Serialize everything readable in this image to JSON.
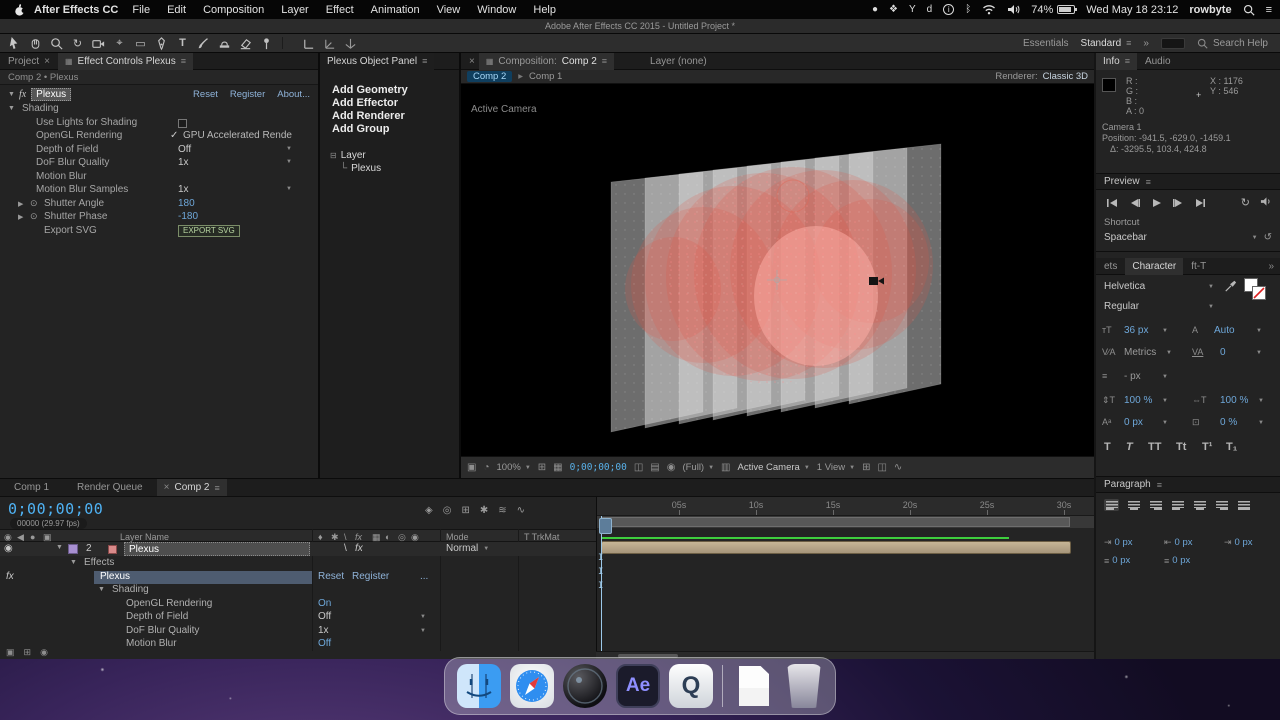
{
  "colors": {
    "accent_blue": "#6ea7d9",
    "timecode_cyan": "#4fb3f5",
    "render_green": "#3ecf3e",
    "layer_bar_tan": "#b3a183",
    "selection_row": "#4e5c70"
  },
  "icons": {
    "menu": "≡",
    "close": "×",
    "dd": "▼",
    "twirl_open": "▼",
    "twirl_closed": "▶",
    "crumb_arrow": "▸",
    "chevrons": "»",
    "check": "✓",
    "stopwatch": "⊙",
    "plus": "+",
    "tree_node": "⊟",
    "tree_branch": "└",
    "panel": "▦",
    "cti": "I",
    "fx": "fx",
    "loop": "↻",
    "rotate_tool": "↻",
    "reset": "↺",
    "pan_behind_tool": "⌖",
    "mask_rect_tool": "▭",
    "type_tool": "T",
    "eye": "◉",
    "audio": "◀",
    "solo": "●",
    "lock": "▣",
    "bullet": "•"
  },
  "menubar": {
    "app_name": "After Effects CC",
    "menus": [
      "File",
      "Edit",
      "Composition",
      "Layer",
      "Effect",
      "Animation",
      "View",
      "Window",
      "Help"
    ],
    "status_icons": [
      "●",
      "❖",
      "Y",
      "d",
      "i",
      "ᛒ"
    ],
    "battery": "74%",
    "clock": "Wed May 18  23:12",
    "user": "rowbyte"
  },
  "titlebar": {
    "title": "Adobe After Effects CC 2015 - Untitled Project *"
  },
  "toolbar": {
    "workspace_a": "Essentials",
    "workspace_b": "Standard",
    "search_placeholder": "Search Help"
  },
  "effect_controls": {
    "tab_project": "Project",
    "tab_active": "Effect Controls Plexus",
    "context": "Comp 2 • Plexus",
    "effect_name": "Plexus",
    "links": {
      "reset": "Reset",
      "register": "Register",
      "about": "About..."
    },
    "rows": [
      {
        "label": "Shading",
        "value": ""
      },
      {
        "label": "Use Lights for Shading",
        "value": ""
      },
      {
        "label": "OpenGL Rendering",
        "value": "GPU Accelerated Rende"
      },
      {
        "label": "Depth of Field",
        "value": "Off"
      },
      {
        "label": "DoF Blur Quality",
        "value": "1x"
      },
      {
        "label": "Motion Blur",
        "value": ""
      },
      {
        "label": "Motion Blur Samples",
        "value": "1x"
      },
      {
        "label": "Shutter Angle",
        "value": "180"
      },
      {
        "label": "Shutter Phase",
        "value": "-180"
      },
      {
        "label": "Export SVG",
        "value": "EXPORT SVG"
      }
    ]
  },
  "plexus_panel": {
    "title": "Plexus Object Panel",
    "buttons": [
      "Add Geometry",
      "Add Effector",
      "Add Renderer",
      "Add Group"
    ],
    "tree_root": "Layer",
    "tree_child": "Plexus"
  },
  "composition": {
    "tab_prefix": "Composition:",
    "tab_comp": "Comp 2",
    "tab_layer": "Layer (none)",
    "crumb_active": "Comp 2",
    "crumb_parent": "Comp 1",
    "renderer_label": "Renderer:",
    "renderer_value": "Classic 3D",
    "view_label": "Active Camera",
    "bar": {
      "zoom": "100%",
      "timecode": "0;00;00;00",
      "resolution": "(Full)",
      "camera": "Active Camera",
      "views": "1 View"
    },
    "bar_icons": {
      "a": [
        "▣",
        "◔"
      ],
      "b": [
        "⊞",
        "▦"
      ],
      "c": [
        "◫",
        "▤",
        "◉"
      ],
      "roi": "▥",
      "d": [
        "⊞",
        "◫",
        "∿"
      ]
    }
  },
  "info": {
    "tab_info": "Info",
    "tab_audio": "Audio",
    "r": "R :",
    "g": "G :",
    "b": "B :",
    "a": "A :    0",
    "x": "X : 1176",
    "y": "Y :   546",
    "camera_name": "Camera 1",
    "position": "Position:  -941.5, -629.0, -1459.1",
    "delta": "Δ:  -3295.5, 103.4, 424.8"
  },
  "preview": {
    "title": "Preview",
    "shortcut_label": "Shortcut",
    "shortcut_value": "Spacebar"
  },
  "character": {
    "tab_left": "ets",
    "tab_active": "Character",
    "tab_right": "ft-T",
    "font_family": "Helvetica",
    "font_style": "Regular",
    "font_size": "36 px",
    "leading": "Auto",
    "kerning": "Metrics",
    "tracking": "0",
    "stroke_width": "- px",
    "v_scale": "100 %",
    "h_scale": "100 %",
    "baseline_shift": "0 px",
    "tsume": "0 %",
    "style_buttons": [
      "T",
      "T",
      "TT",
      "Tt",
      "T¹",
      "T₁"
    ],
    "icon_size": "ᴛT",
    "icon_leading": "A",
    "icon_kern": "V∕A",
    "icon_track": "VA",
    "icon_stroke": "≡",
    "icon_vscale": "⇕T",
    "icon_hscale": "⇔T",
    "icon_baseline": "Aᵃ",
    "icon_tsume": "⊡"
  },
  "paragraph": {
    "title": "Paragraph",
    "fields": [
      "0 px",
      "0 px",
      "0 px",
      "0 px",
      "0 px"
    ],
    "field_icons": [
      "⇥",
      "⇤",
      "⇥",
      "≡",
      "≡"
    ]
  },
  "timeline": {
    "tab_comp1": "Comp 1",
    "tab_rq": "Render Queue",
    "tab_active": "Comp 2",
    "timecode": "0;00;00;00",
    "frames": "00000 (29.97 fps)",
    "col_layer_name": "Layer Name",
    "col_mode": "Mode",
    "col_trkmat": "T    TrkMat",
    "av_icons": [
      "◉",
      "◀",
      "●",
      "▣"
    ],
    "switch_icons": [
      "♦",
      "✱",
      "\\",
      "fx",
      "▦",
      "◐",
      "◎",
      "◉"
    ],
    "mini_icons": [
      "◈",
      "◎",
      "⊞",
      "✱",
      "≋",
      "∿"
    ],
    "corner_icons": [
      "▣",
      "⊞",
      "◉"
    ],
    "layer_index": "2",
    "layer_name": "Plexus",
    "layer_mode": "Normal",
    "row_effects": "Effects",
    "row_plexus": "Plexus",
    "row_shading": "Shading",
    "links": {
      "reset": "Reset",
      "register": "Register",
      "more": "..."
    },
    "rows": [
      {
        "label": "OpenGL Rendering",
        "value": "On"
      },
      {
        "label": "Depth of Field",
        "value": "Off"
      },
      {
        "label": "DoF Blur Quality",
        "value": "1x"
      },
      {
        "label": "Motion Blur",
        "value": "Off"
      }
    ],
    "ruler_ticks": [
      "05s",
      "10s",
      "15s",
      "20s",
      "25s",
      "30s"
    ]
  },
  "dock": {
    "ae": "Ae",
    "q": "Q"
  }
}
